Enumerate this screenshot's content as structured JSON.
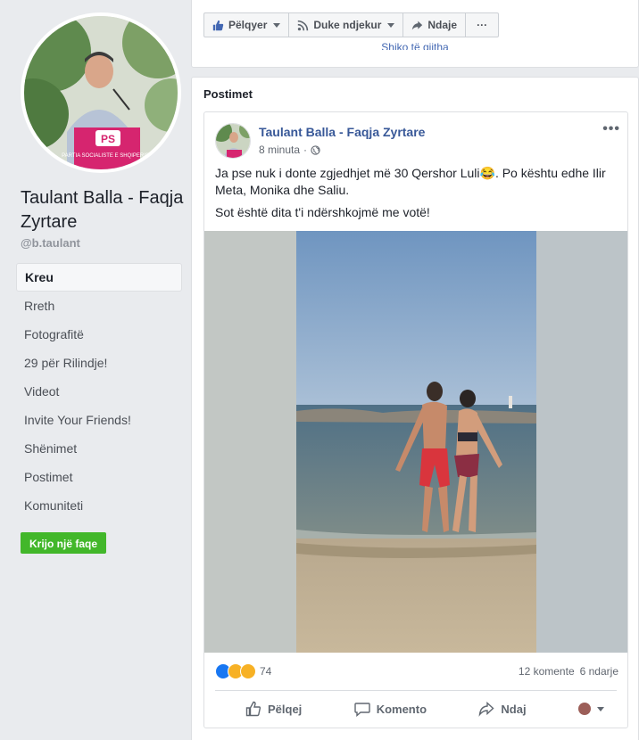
{
  "page": {
    "name": "Taulant Balla - Faqja Zyrtare",
    "handle": "@b.taulant",
    "podium_logo": "PS",
    "podium_text": "PARTIA SOCIALISTE E SHQIPERISE"
  },
  "sidebar": {
    "items": [
      {
        "label": "Kreu",
        "active": true
      },
      {
        "label": "Rreth"
      },
      {
        "label": "Fotografitë"
      },
      {
        "label": "29 për Rilindje!"
      },
      {
        "label": "Videot"
      },
      {
        "label": "Invite Your Friends!"
      },
      {
        "label": "Shënimet"
      },
      {
        "label": "Postimet"
      },
      {
        "label": "Komuniteti"
      }
    ],
    "create_page_label": "Krijo një faqe"
  },
  "action_bar": {
    "like_label": "Pëlqyer",
    "follow_label": "Duke ndjekur",
    "share_label": "Ndaje",
    "more_label": "···",
    "see_all_label": "Shiko të gjitha"
  },
  "posts_section": {
    "title": "Postimet"
  },
  "post": {
    "author": "Taulant Balla - Faqja Zyrtare",
    "time": "8 minuta",
    "separator": "·",
    "audience_icon": "globe-icon",
    "more_label": "•••",
    "text_line1": "Ja pse nuk i donte zgjedhjet më 30 Qershor Luli😂. Po kështu edhe Ilir Meta, Monika dhe Saliu.",
    "text_line2": "Sot është dita t'i ndërshkojmë me votë!",
    "reaction_count": "74",
    "comments_count": "12 komente",
    "shares_count": "6 ndarje",
    "like_action": "Pëlqej",
    "comment_action": "Komento",
    "share_action": "Ndaj"
  },
  "colors": {
    "link_blue": "#385898",
    "brand_blue": "#4267b2",
    "green_button": "#42b72a",
    "ps_pink": "#d6256f"
  }
}
